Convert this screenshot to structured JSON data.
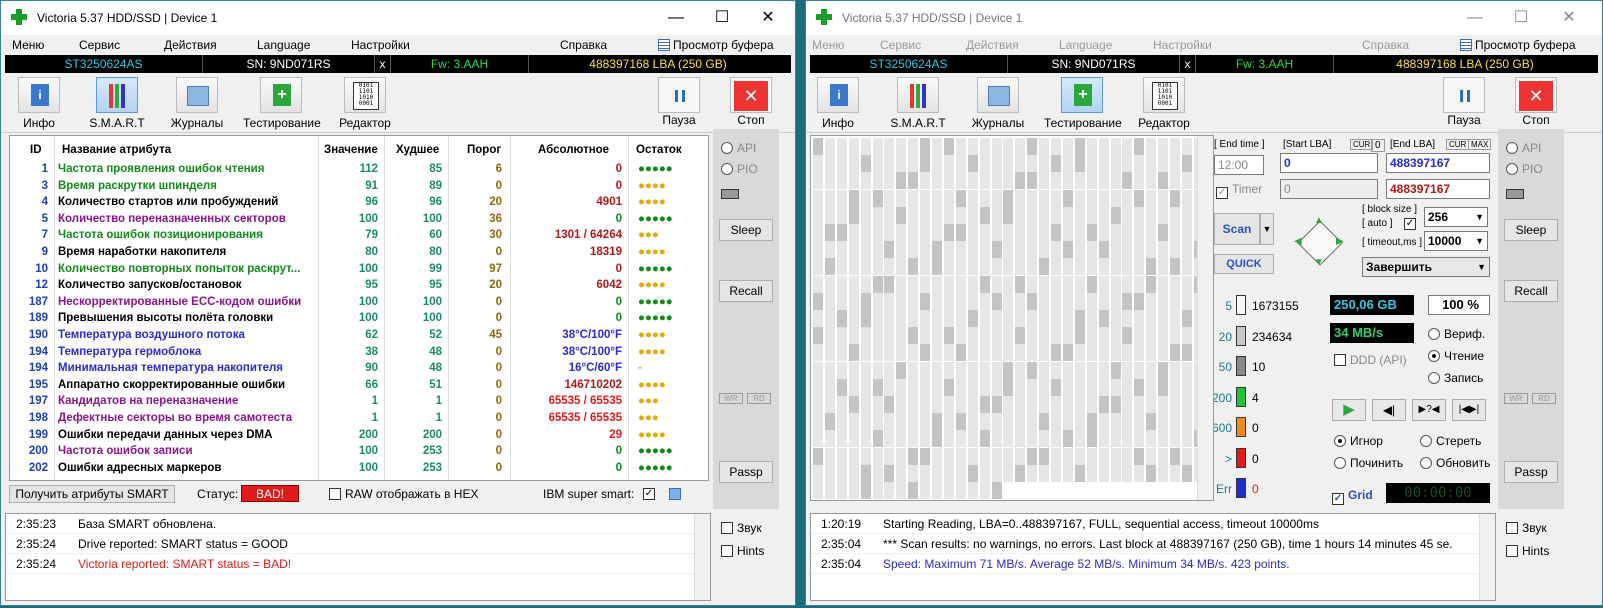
{
  "left": {
    "title": "Victoria 5.37 HDD/SSD | Device 1",
    "menu": [
      "Меню",
      "Сервис",
      "Действия",
      "Language",
      "Настройки",
      "Справка"
    ],
    "buffer": "Просмотр буфера",
    "info": {
      "model": "ST3250624AS",
      "sn": "SN: 9ND071RS",
      "x": "x",
      "fw": "Fw: 3.AAH",
      "lba": "488397168 LBA (250 GB)"
    },
    "tabs": [
      "Инфо",
      "S.M.A.R.T",
      "Журналы",
      "Тестирование",
      "Редактор"
    ],
    "pause": "Пауза",
    "stop": "Стоп",
    "headers": [
      "ID",
      "Название атрибута",
      "Значение",
      "Худшее",
      "Порог",
      "Абсолютное",
      "Остаток"
    ],
    "rows": [
      {
        "id": "1",
        "name": "Частота проявления ошибок чтения",
        "v": "112",
        "w": "85",
        "t": "6",
        "a": "0",
        "o": "●●●●●",
        "nc": "#148a1d",
        "ac": "#b41818"
      },
      {
        "id": "3",
        "name": "Время раскрутки шпинделя",
        "v": "91",
        "w": "89",
        "t": "0",
        "a": "0",
        "o": "●●●●",
        "nc": "#148a1d",
        "ac": "#b41818"
      },
      {
        "id": "4",
        "name": "Количество стартов или пробуждений",
        "v": "96",
        "w": "96",
        "t": "20",
        "a": "4901",
        "o": "●●●●",
        "nc": "#000",
        "ac": "#b41818"
      },
      {
        "id": "5",
        "name": "Количество переназначенных секторов",
        "v": "100",
        "w": "100",
        "t": "36",
        "a": "0",
        "o": "●●●●●",
        "nc": "#8a168e",
        "ac": "#148a1d"
      },
      {
        "id": "7",
        "name": "Частота ошибок позиционирования",
        "v": "79",
        "w": "60",
        "t": "30",
        "a": "1301 / 64264",
        "o": "●●●",
        "nc": "#148a1d",
        "ac": "#b41818"
      },
      {
        "id": "9",
        "name": "Время наработки накопителя",
        "v": "80",
        "w": "80",
        "t": "0",
        "a": "18319",
        "o": "●●●●",
        "nc": "#000",
        "ac": "#b41818"
      },
      {
        "id": "10",
        "name": "Количество повторных попыток раскрут...",
        "v": "100",
        "w": "99",
        "t": "97",
        "a": "0",
        "o": "●●●●●",
        "nc": "#148a1d",
        "ac": "#b41818"
      },
      {
        "id": "12",
        "name": "Количество запусков/остановок",
        "v": "95",
        "w": "95",
        "t": "20",
        "a": "6042",
        "o": "●●●●",
        "nc": "#000",
        "ac": "#b41818"
      },
      {
        "id": "187",
        "name": "Нескорректированные ECC-кодом ошибки",
        "v": "100",
        "w": "100",
        "t": "0",
        "a": "0",
        "o": "●●●●●",
        "nc": "#8a168e",
        "ac": "#148a1d"
      },
      {
        "id": "189",
        "name": "Превышения высоты полёта головки",
        "v": "100",
        "w": "100",
        "t": "0",
        "a": "0",
        "o": "●●●●●",
        "nc": "#000",
        "ac": "#148a1d"
      },
      {
        "id": "190",
        "name": "Температура воздушного потока",
        "v": "62",
        "w": "52",
        "t": "45",
        "a": "38°C/100°F",
        "o": "●●●●",
        "nc": "#2a2ae0",
        "ac": "#2a2ae0"
      },
      {
        "id": "194",
        "name": "Температура гермоблока",
        "v": "38",
        "w": "48",
        "t": "0",
        "a": "38°C/100°F",
        "o": "●●●●",
        "nc": "#2a2ae0",
        "ac": "#2a2ae0"
      },
      {
        "id": "194",
        "name": "Минимальная температура накопителя",
        "v": "90",
        "w": "48",
        "t": "0",
        "a": "16°C/60°F",
        "o": "-",
        "nc": "#2a2ae0",
        "ac": "#2a2ae0"
      },
      {
        "id": "195",
        "name": "Аппаратно скорректированные ошибки",
        "v": "66",
        "w": "51",
        "t": "0",
        "a": "146710202",
        "o": "●●●●",
        "nc": "#000",
        "ac": "#b41818"
      },
      {
        "id": "197",
        "name": "Кандидатов на переназначение",
        "v": "1",
        "w": "1",
        "t": "0",
        "a": "65535 / 65535",
        "o": "●●●",
        "nc": "#8a168e",
        "ac": "#e21a1a"
      },
      {
        "id": "198",
        "name": "Дефектные секторы во время самотеста",
        "v": "1",
        "w": "1",
        "t": "0",
        "a": "65535 / 65535",
        "o": "●●●",
        "nc": "#8a168e",
        "ac": "#e21a1a"
      },
      {
        "id": "199",
        "name": "Ошибки передачи данных через DMA",
        "v": "200",
        "w": "200",
        "t": "0",
        "a": "29",
        "o": "●●●●",
        "nc": "#000",
        "ac": "#e21a1a"
      },
      {
        "id": "200",
        "name": "Частота ошибок записи",
        "v": "100",
        "w": "253",
        "t": "0",
        "a": "0",
        "o": "●●●●●",
        "nc": "#8a168e",
        "ac": "#148a1d"
      },
      {
        "id": "202",
        "name": "Ошибки адресных маркеров",
        "v": "100",
        "w": "253",
        "t": "0",
        "a": "0",
        "o": "●●●●●",
        "nc": "#000",
        "ac": "#148a1d"
      }
    ],
    "get_smart": "Получить атрибуты SMART",
    "status_label": "Статус:",
    "status": "BAD!",
    "raw_hex": "RAW отображать в HEX",
    "ibm": "IBM super smart:",
    "side": {
      "api": "API",
      "pio": "PIO",
      "sleep": "Sleep",
      "recall": "Recall",
      "wr": "WR",
      "rd": "RD",
      "passp": "Passp"
    },
    "log": [
      {
        "t": "2:35:23",
        "m": "База SMART обновлена.",
        "c": "#000"
      },
      {
        "t": "2:35:24",
        "m": "Drive reported: SMART status = GOOD",
        "c": "#000"
      },
      {
        "t": "2:35:24",
        "m": "Victoria reported: SMART status = BAD!",
        "c": "#e21a1a"
      }
    ],
    "sound": "Звук",
    "hints": "Hints"
  },
  "right": {
    "endtime": "[ End time ]",
    "startlba": "[Start LBA]",
    "cur": "CUR",
    "zero": "0",
    "endlba": "[End LBA]",
    "max": "MAX",
    "time": "12:00",
    "start_val": "0",
    "end_val": "488397167",
    "timer": "Timer",
    "timer_val": "0",
    "end_val2": "488397167",
    "scan": "Scan",
    "quick": "QUICK",
    "blocksize": "[ block size ]",
    "auto": "[ auto ]",
    "block_val": "256",
    "timeout": "[ timeout,ms ]",
    "timeout_val": "10000",
    "finish": "Завершить",
    "hist": [
      {
        "l": "5",
        "v": "1673155",
        "c": "#f8f8f8"
      },
      {
        "l": "20",
        "v": "234634",
        "c": "#c8c8c8"
      },
      {
        "l": "50",
        "v": "10",
        "c": "#8a8a8a"
      },
      {
        "l": "200",
        "v": "4",
        "c": "#25c03a"
      },
      {
        "l": "600",
        "v": "0",
        "c": "#f08a18"
      },
      {
        "l": ">",
        "v": "0",
        "c": "#e21a1a"
      },
      {
        "l": "Err",
        "v": "0",
        "c": "#2030d0"
      }
    ],
    "gb": "250,06 GB",
    "pct": "100  %",
    "speed": "34 MB/s",
    "ddd": "DDD (API)",
    "verify": "Вериф.",
    "read": "Чтение",
    "write": "Запись",
    "ignore": "Игнор",
    "erase": "Стереть",
    "repair": "Починить",
    "refresh": "Обновить",
    "grid": "Grid",
    "timer_led": "00:00:00",
    "log": [
      {
        "t": "1:20:19",
        "m": "Starting Reading, LBA=0..488397167, FULL, sequential access, timeout 10000ms",
        "c": "#000"
      },
      {
        "t": "2:35:04",
        "m": "*** Scan results: no warnings, no errors. Last block at 488397167 (250 GB), time 1 hours 14 minutes 45 se.",
        "c": "#000"
      },
      {
        "t": "2:35:04",
        "m": "Speed: Maximum 71 MB/s. Average 52 MB/s. Minimum 34 MB/s. 423 points.",
        "c": "#2a2ae0"
      }
    ]
  }
}
